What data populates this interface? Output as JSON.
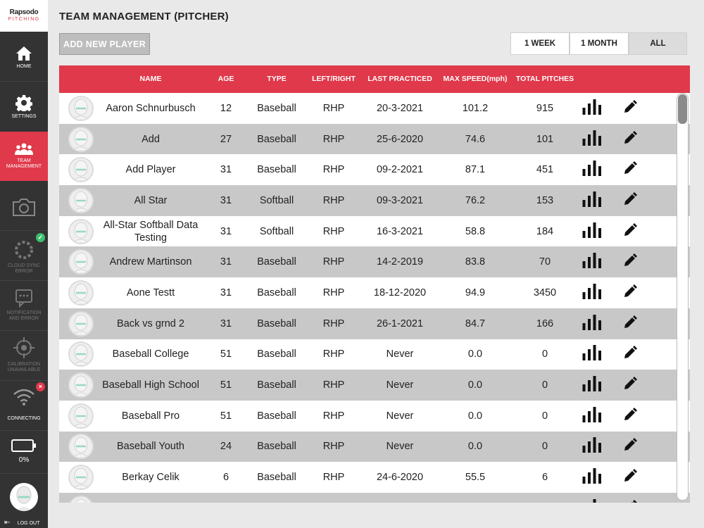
{
  "app": {
    "brand": "Rapsodo",
    "brand_sub": "PITCHING"
  },
  "sidebar": {
    "items": [
      {
        "id": "home",
        "label": "HOME",
        "icon": "home-icon",
        "state": "normal"
      },
      {
        "id": "settings",
        "label": "SETTINGS",
        "icon": "gear-icon",
        "state": "normal"
      },
      {
        "id": "team",
        "label": "TEAM\nMANAGEMENT",
        "icon": "team-icon",
        "state": "active"
      },
      {
        "id": "camera",
        "label": "",
        "icon": "camera-icon",
        "state": "dim"
      },
      {
        "id": "cloud",
        "label": "CLOUD SYNC\nERROR",
        "icon": "cloud-sync-icon",
        "state": "dim"
      },
      {
        "id": "notification",
        "label": "NOTIFICATION\nAND ERROR",
        "icon": "notification-icon",
        "state": "dim"
      },
      {
        "id": "calibration",
        "label": "CALIBRATION\nUNAVAILABLE",
        "icon": "crosshair-icon",
        "state": "dim"
      },
      {
        "id": "wifi",
        "label": "CONNECTING",
        "icon": "wifi-icon",
        "state": "normal"
      }
    ],
    "battery_label": "0%",
    "logout_label": "LOG OUT"
  },
  "page": {
    "title": "TEAM MANAGEMENT (PITCHER)",
    "add_button": "ADD NEW PLAYER",
    "ranges": [
      "1 WEEK",
      "1 MONTH",
      "ALL"
    ],
    "selected_range": "ALL"
  },
  "table": {
    "columns": [
      "NAME",
      "AGE",
      "TYPE",
      "LEFT/RIGHT",
      "LAST PRACTICED",
      "MAX SPEED(mph)",
      "TOTAL PITCHES"
    ],
    "rows": [
      [
        "Aaron Schnurbusch",
        "12",
        "Baseball",
        "RHP",
        "20-3-2021",
        "101.2",
        "915"
      ],
      [
        "Add",
        "27",
        "Baseball",
        "RHP",
        "25-6-2020",
        "74.6",
        "101"
      ],
      [
        "Add Player",
        "31",
        "Baseball",
        "RHP",
        "09-2-2021",
        "87.1",
        "451"
      ],
      [
        "All Star",
        "31",
        "Softball",
        "RHP",
        "09-3-2021",
        "76.2",
        "153"
      ],
      [
        "All-Star Softball Data Testing",
        "31",
        "Softball",
        "RHP",
        "16-3-2021",
        "58.8",
        "184"
      ],
      [
        "Andrew Martinson",
        "31",
        "Baseball",
        "RHP",
        "14-2-2019",
        "83.8",
        "70"
      ],
      [
        "Aone Testt",
        "31",
        "Baseball",
        "RHP",
        "18-12-2020",
        "94.9",
        "3450"
      ],
      [
        "Back vs grnd 2",
        "31",
        "Baseball",
        "RHP",
        "26-1-2021",
        "84.7",
        "166"
      ],
      [
        "Baseball College",
        "51",
        "Baseball",
        "RHP",
        "Never",
        "0.0",
        "0"
      ],
      [
        "Baseball High School",
        "51",
        "Baseball",
        "RHP",
        "Never",
        "0.0",
        "0"
      ],
      [
        "Baseball Pro",
        "51",
        "Baseball",
        "RHP",
        "Never",
        "0.0",
        "0"
      ],
      [
        "Baseball Youth",
        "24",
        "Baseball",
        "RHP",
        "Never",
        "0.0",
        "0"
      ],
      [
        "Berkay Celik",
        "6",
        "Baseball",
        "RHP",
        "24-6-2020",
        "55.5",
        "6"
      ],
      [
        "",
        "",
        "",
        "",
        "",
        "",
        ""
      ]
    ]
  },
  "colors": {
    "accent": "#e0394b",
    "sidebar": "#333333",
    "row_alt": "#c8c8c8",
    "ok": "#3dbf6e"
  }
}
